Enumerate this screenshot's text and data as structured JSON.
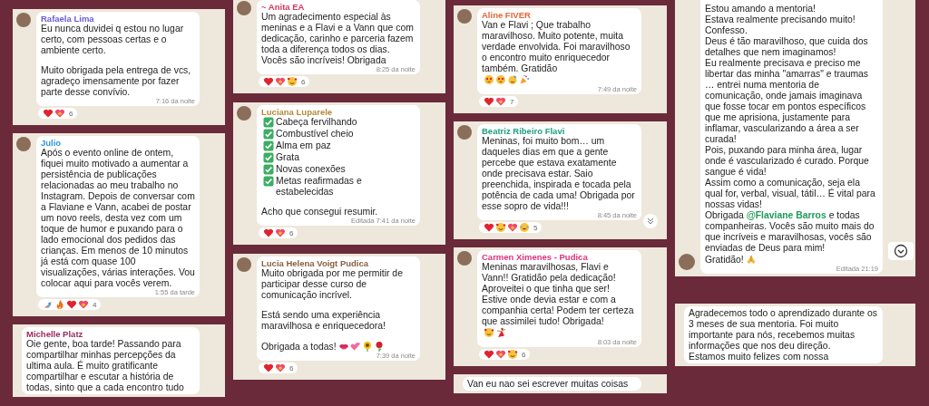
{
  "columns": [
    {
      "panels": [
        {
          "avatar": {
            "kind": "top"
          },
          "sender": "Rafaela Lima",
          "color": "#6a5bd8",
          "paragraphs": [
            [
              [
                "Eu nunca duvidei q estou no lugar certo, com pessoas certas e o ambiente certo."
              ]
            ],
            [
              [
                "Muito obrigada pela entrega de vcs, agradeço imensamente por fazer parte desse convívio."
              ]
            ]
          ],
          "time": "7:16 da noite",
          "reactions": {
            "icons": [
              {
                "kind": "heart"
              },
              {
                "kind": "heart-glow"
              }
            ],
            "count": "6"
          }
        },
        {
          "avatar": {
            "kind": "top"
          },
          "sender": "Julio",
          "color": "#2f95d6",
          "paragraphs": [
            [
              [
                "Após o evento online de ontem, fiquei muito motivado a aumentar a persistência de publicações relacionadas ao meu trabalho no Instagram. Depois de conversar com a Flaviane e Vann, acabei de postar um novo reels, desta vez com um toque de humor e puxando para o lado emocional dos pedidos das crianças. Em menos de 10 minutos já está com quase 100 visualizações, várias interações. Vou colocar aqui para vocês verem."
              ]
            ]
          ],
          "time": "1:55 da tarde",
          "reactions": {
            "icons": [
              {
                "kind": "rocket"
              },
              {
                "kind": "fire"
              },
              {
                "kind": "heart"
              },
              {
                "kind": "heart-glow"
              }
            ],
            "count": "4"
          }
        },
        {
          "sender": "Michelle Platz",
          "color": "#9c2a5e",
          "paragraphs": [
            [
              [
                "Oie gente, boa tarde! Passando para compartilhar minhas percepções da ultima aula. É muito gratificante compartilhar e escutar a história de todas, sinto que a cada encontro tudo"
              ]
            ]
          ]
        }
      ]
    },
    {
      "panels": [
        {
          "avatar": {
            "kind": "top"
          },
          "sender": "~ Anita EA",
          "color": "#d4365f",
          "paragraphs": [
            [
              [
                "Um agradecimento especial às meninas e a Flavi e a Vann que com dedicação, carinho e parceria fazem toda a diferença todos os dias. Vocês são incríveis! Obrigada"
              ]
            ]
          ],
          "time": "8:25 da noite",
          "reactions": {
            "icons": [
              {
                "kind": "heart"
              },
              {
                "kind": "heart-glow"
              },
              {
                "kind": "face-hearts"
              }
            ],
            "count": "6"
          }
        },
        {
          "avatar": {
            "kind": "top"
          },
          "sender": "Luciana Luparele",
          "color": "#b08a3a",
          "paragraphs": [
            [
              [
                {
                  "kind": "check"
                },
                "Cabeça fervilhando"
              ],
              [
                {
                  "kind": "check"
                },
                "Combustível cheio"
              ],
              [
                {
                  "kind": "check"
                },
                "Alma em paz"
              ],
              [
                {
                  "kind": "check"
                },
                "Grata"
              ],
              [
                {
                  "kind": "check"
                },
                "Novas conexões"
              ],
              [
                {
                  "kind": "check"
                },
                "Metas reafirmadas e estabelecidas"
              ]
            ],
            [
              [
                "Acho que consegui resumir."
              ]
            ]
          ],
          "time": "Editada 7:41 da noite",
          "reactions": {
            "icons": [
              {
                "kind": "heart"
              },
              {
                "kind": "heart-glow"
              }
            ],
            "count": "6"
          }
        },
        {
          "avatar": {
            "kind": "top"
          },
          "sender": "Lucia Helena Voigt Pudica",
          "color": "#8a6242",
          "paragraphs": [
            [
              [
                "Muito obrigada por me permitir de participar desse curso de comunicação incrível."
              ]
            ],
            [
              [
                "Está sendo  uma experiência maravilhosa e enriquecedora!"
              ]
            ],
            [
              [
                "Obrigada a todas!",
                {
                  "kind": "lips"
                },
                {
                  "kind": "two-hearts"
                },
                {
                  "kind": "sunflower"
                },
                {
                  "kind": "rose"
                }
              ]
            ]
          ],
          "time": "7:39 da noite",
          "reactions": {
            "icons": [
              {
                "kind": "heart"
              },
              {
                "kind": "heart-glow"
              }
            ],
            "count": "6"
          }
        }
      ]
    },
    {
      "panels": [
        {
          "avatar": {
            "kind": "top"
          },
          "sender": "Aline FIVER",
          "color": "#e0683a",
          "paragraphs": [
            [
              [
                "Van e Flavi ; Que trabalho maravilhoso. Muito potente, muita verdade envolvida.  Foi maravilhoso o encontro muito enriquecedor também. Gratidão",
                {
                  "kind": "heart-eyes"
                },
                {
                  "kind": "heart-eyes"
                },
                {
                  "kind": "party-face"
                },
                {
                  "kind": "popper"
                }
              ]
            ]
          ],
          "time": "7:49 da noite",
          "reactions": {
            "icons": [
              {
                "kind": "heart"
              },
              {
                "kind": "heart-glow"
              }
            ],
            "count": "7"
          }
        },
        {
          "avatar": {
            "kind": "top"
          },
          "sender": "Beatriz Ribeiro Flavi",
          "color": "#1d9e86",
          "paragraphs": [
            [
              [
                "Meninas, foi muito bom… um daqueles dias em que a gente percebe que estava exatamente onde precisava estar. Saio preenchida, inspirada e tocada pela potência de cada uma! Obrigada por esse sopro de vida!!!"
              ]
            ]
          ],
          "time": "8:45 da noite",
          "reactions": {
            "icons": [
              {
                "kind": "heart"
              },
              {
                "kind": "face-hearts"
              },
              {
                "kind": "heart-glow"
              },
              {
                "kind": "joy"
              }
            ],
            "count": "5"
          },
          "scroll_button": {
            "kind": "double"
          }
        },
        {
          "avatar": {
            "kind": "top"
          },
          "sender": "Carmen Ximenes - Pudica",
          "color": "#e0307a",
          "paragraphs": [
            [
              [
                "Meninas maravilhosas, Flavi e Vann!! Gratidão pela dedicação! Aproveitei o que tinha que ser! Estive onde devia estar e com a companhia certa! Podem ter certeza que assimilei tudo! Obrigada!",
                {
                  "kind": "face-hearts"
                },
                {
                  "kind": "dancer"
                }
              ]
            ]
          ],
          "time": "8:03 da noite",
          "reactions": {
            "icons": [
              {
                "kind": "heart"
              },
              {
                "kind": "heart-glow"
              },
              {
                "kind": "face-hearts"
              }
            ],
            "count": "6"
          }
        },
        {
          "paragraphs": [
            [
              [
                "Van eu nao sei escrever muitas coisas"
              ]
            ]
          ]
        }
      ]
    },
    {
      "panels": [
        {
          "avatar": {
            "kind": "bottom"
          },
          "paragraphs": [
            [
              [
                "Estou amando a mentoria!"
              ],
              [
                "Estava realmente precisando muito!"
              ],
              [
                "Confesso."
              ],
              [
                "Deus é tão maravilhoso, que cuida dos detalhes que nem imaginamos!"
              ],
              [
                "Eu realmente precisava e preciso me libertar das minha \"amarras\" e traumas … entrei numa mentoria de comunicação, onde jamais imaginava que fosse tocar em pontos específicos que me aprisiona, justamente para inflamar, vascularizando a área a ser curada!"
              ],
              [
                "Pois, puxando para minha área, lugar onde é vascularizado é curado. Porque sangue é vida!"
              ],
              [
                "Assim como a comunicação, seja ela qual for, verbal, visual, tátil… É vital para nossas vidas!"
              ],
              [
                "Obrigada ",
                {
                  "kind": "mention",
                  "text": "@Flaviane Barros"
                },
                " e todas companheiras. Vocês são muito mais do que incríveis e maravilhosas, vocês são enviadas de Deus para mim!"
              ],
              [
                "Gratidão!",
                {
                  "kind": "pray"
                }
              ]
            ]
          ],
          "time": "Editada 21:19",
          "scroll_button": {
            "kind": "circle"
          }
        },
        {
          "paragraphs": [
            [
              [
                "Agradecemos todo o aprendizado durante os 3 meses de sua mentoria. Foi muito importante para nós, recebemos muitas informações que nos deu direção."
              ],
              [
                "Estamos muito felizes com nossa"
              ]
            ]
          ]
        }
      ]
    }
  ]
}
